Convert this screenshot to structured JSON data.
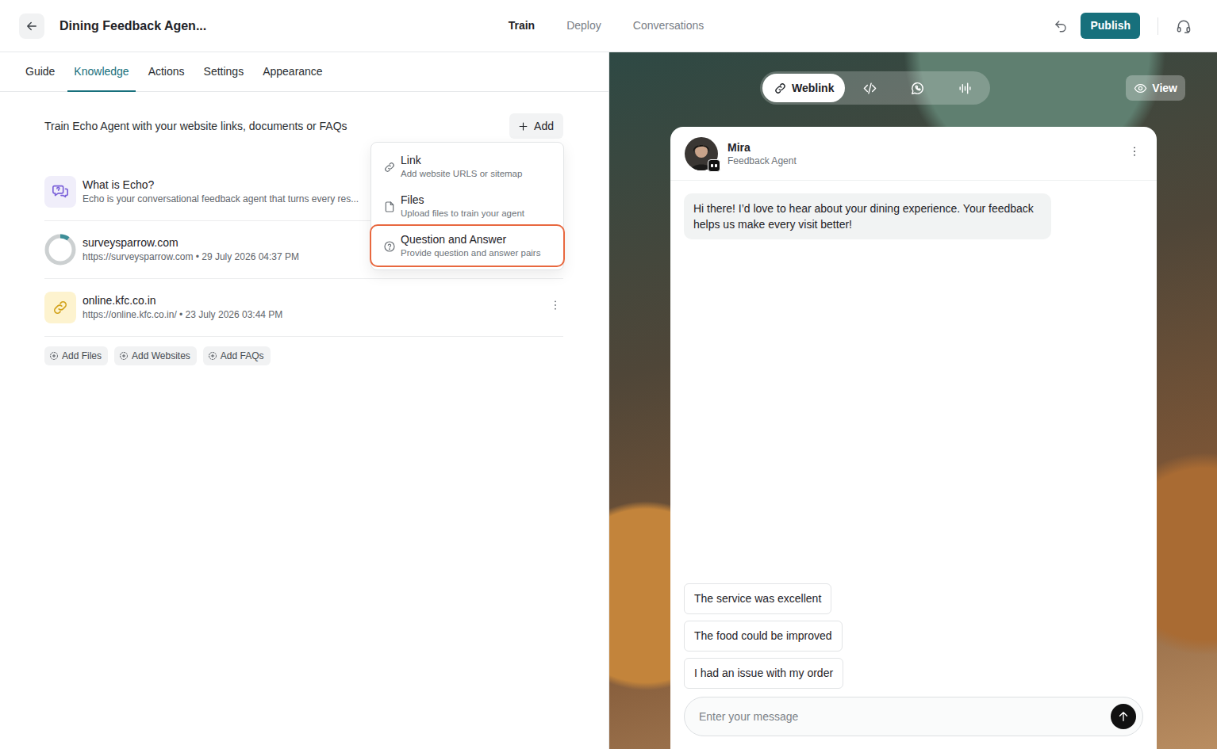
{
  "header": {
    "title": "Dining Feedback Agen...",
    "nav": [
      {
        "label": "Train",
        "selected": true
      },
      {
        "label": "Deploy",
        "selected": false
      },
      {
        "label": "Conversations",
        "selected": false
      }
    ],
    "publish": "Publish"
  },
  "subtabs": [
    {
      "label": "Guide",
      "selected": false
    },
    {
      "label": "Knowledge",
      "selected": true
    },
    {
      "label": "Actions",
      "selected": false
    },
    {
      "label": "Settings",
      "selected": false
    },
    {
      "label": "Appearance",
      "selected": false
    }
  ],
  "knowledge": {
    "intro": "Train Echo Agent with your website links, documents or FAQs",
    "add_button": "Add",
    "sources": [
      {
        "kind": "faq",
        "title": "What is Echo?",
        "subtitle": "Echo is your conversational feedback agent that turns every res..."
      },
      {
        "kind": "progress",
        "title": "surveysparrow.com",
        "subtitle": "https://surveysparrow.com • 29 July 2026 04:37 PM",
        "level": 0.1
      },
      {
        "kind": "link",
        "title": "online.kfc.co.in",
        "subtitle": "https://online.kfc.co.in/ • 23 July 2026 03:44 PM"
      }
    ],
    "quick_add": [
      "Add Files",
      "Add Websites",
      "Add FAQs"
    ]
  },
  "add_menu": {
    "open": true,
    "items": [
      {
        "kind": "link",
        "title": "Link",
        "description": "Add website URLS or sitemap",
        "selected": false
      },
      {
        "kind": "files",
        "title": "Files",
        "description": "Upload files to train your agent",
        "selected": false
      },
      {
        "kind": "qa",
        "title": "Question and Answer",
        "description": "Provide question and answer pairs",
        "selected": true
      }
    ]
  },
  "preview": {
    "channels": [
      {
        "kind": "weblink",
        "label": "Weblink",
        "selected": true
      },
      {
        "kind": "embed",
        "selected": false
      },
      {
        "kind": "whatsapp",
        "selected": false
      },
      {
        "kind": "voice",
        "selected": false
      }
    ],
    "view_button": "View"
  },
  "chat": {
    "agent_name": "Mira",
    "agent_role": "Feedback Agent",
    "messages": [
      {
        "from": "agent",
        "text": "Hi there! I’d love to hear about your dining experience. Your feedback helps us make every visit better!"
      }
    ],
    "suggestions": [
      "The service was excellent",
      "The food could be improved",
      "I had an issue with my order"
    ],
    "input_placeholder": "Enter your message"
  }
}
